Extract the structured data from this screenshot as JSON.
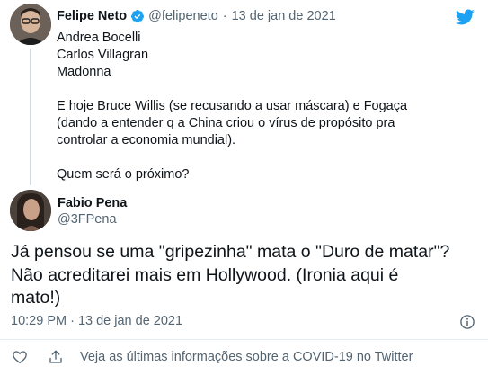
{
  "tweet1": {
    "author": "Felipe Neto",
    "handle": "@felipeneto",
    "separator": "·",
    "date": "13 de jan de 2021",
    "lines": [
      "Andrea Bocelli",
      "Carlos Villagran",
      "Madonna",
      "",
      "E hoje Bruce Willis (se recusando a usar máscara) e Fogaça",
      "(dando a entender q a China criou o vírus de propósito pra",
      "controlar a economia mundial).",
      "",
      "Quem será o próximo?"
    ]
  },
  "tweet2": {
    "author": "Fabio Pena",
    "handle": "@3FPena",
    "lines": [
      "Já pensou se uma \"gripezinha\" mata o \"Duro de matar\"?",
      "Não acreditarei mais em Hollywood. (Ironia aqui é",
      "mato!)"
    ],
    "timestamp": "10:29 PM · 13 de jan de 2021"
  },
  "footer": {
    "covid_link": "Veja as últimas informações sobre a COVID-19 no Twitter"
  },
  "colors": {
    "twitter_blue": "#1da1f2",
    "muted_text": "#536471",
    "thread_line": "#cfd9de"
  },
  "icons": {
    "brand": "twitter-bird-icon",
    "verified": "verified-badge-icon",
    "info": "info-icon",
    "like": "heart-icon",
    "share": "share-icon"
  }
}
